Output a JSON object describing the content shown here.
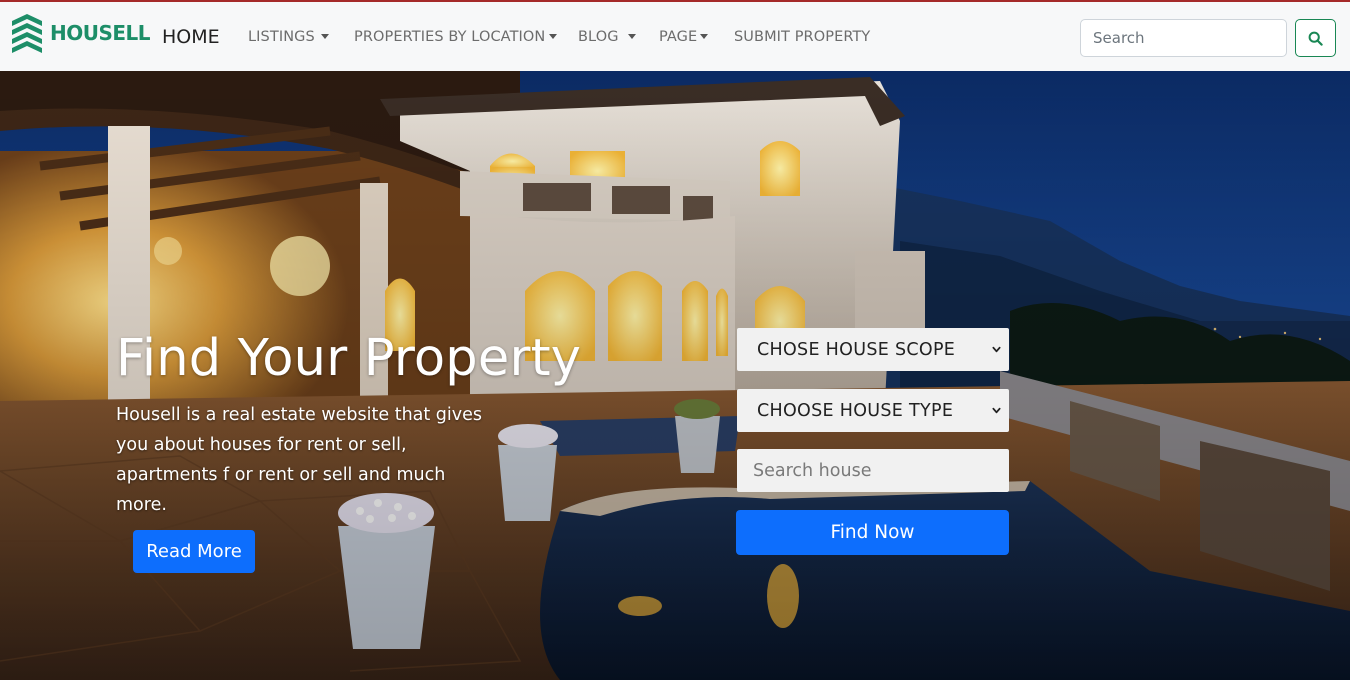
{
  "brand": {
    "name": "HOUSELL",
    "logo_icon": "stacked-chevrons-logo",
    "color": "#1d8e68"
  },
  "nav": {
    "home": "HOME",
    "items": [
      {
        "label": "LISTINGS",
        "has_dropdown": true
      },
      {
        "label": "PROPERTIES BY LOCATION",
        "has_dropdown": true
      },
      {
        "label": "BLOG",
        "has_dropdown": true
      },
      {
        "label": "PAGE",
        "has_dropdown": true
      },
      {
        "label": "SUBMIT PROPERTY",
        "has_dropdown": false
      }
    ]
  },
  "search": {
    "placeholder": "Search",
    "value": "",
    "button_icon": "search-icon",
    "button_color": "#198754"
  },
  "hero": {
    "title": "Find Your Property",
    "description_lines": [
      "Housell is a real estate website that gives",
      "you about houses for rent or sell,",
      "apartments f or rent or sell and much more."
    ],
    "read_more": "Read More",
    "scope_select": "CHOSE HOUSE SCOPE",
    "type_select": "CHOOSE HOUSE TYPE",
    "house_search_placeholder": "Search house",
    "find_now": "Find Now",
    "accent_color": "#0d6efd"
  }
}
